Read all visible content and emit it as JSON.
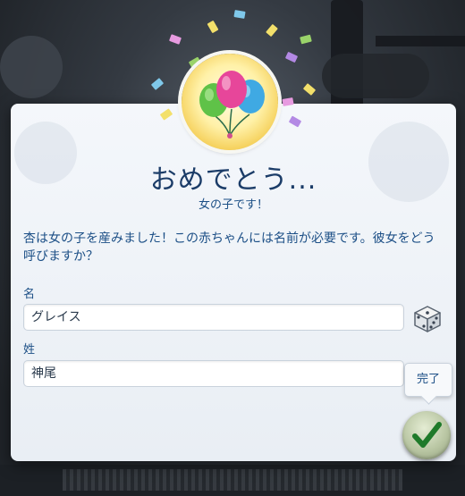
{
  "dialog": {
    "title": "おめでとう...",
    "subtitle": "女の子です！",
    "message": "杏は女の子を産みました！この赤ちゃんには名前が必要です。彼女をどう呼びますか？",
    "first_name": {
      "label": "名",
      "value": "グレイス"
    },
    "last_name": {
      "label": "姓",
      "value": "神尾"
    },
    "done_tooltip": "完了"
  },
  "icons": {
    "badge": "balloons-icon",
    "randomize": "dice-icon",
    "confirm": "checkmark-icon"
  },
  "colors": {
    "title": "#1b3c68",
    "text": "#1c4f86",
    "confirm_check": "#1f7a2a",
    "badge_gold": "#f3c94a"
  }
}
